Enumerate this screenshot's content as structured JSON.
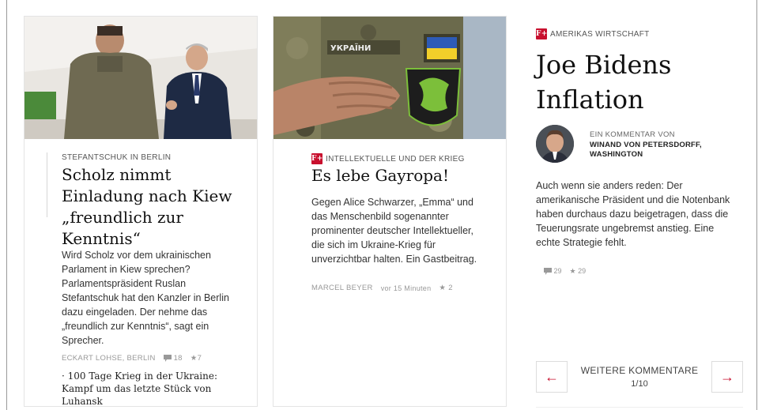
{
  "article1": {
    "kicker": "STEFANTSCHUK IN BERLIN",
    "headline": "Scholz nimmt Einladung nach Kiew „freundlich zur Kenntnis“",
    "teaser": "Wird Scholz vor dem ukrainischen Parlament in Kiew sprechen? Parlamentspräsident Ruslan Stefantschuk hat den Kanzler in Berlin dazu eingeladen. Der nehme das „freundlich zur Kenntnis“, sagt ein Sprecher.",
    "author": "ECKART LOHSE, BERLIN",
    "comments": "18",
    "stars": "7",
    "related": "· 100 Tage Krieg in der Ukraine: Kampf um das letzte Stück von Luhansk"
  },
  "article2": {
    "badge": "F+",
    "kicker": "INTELLEKTUELLE UND DER KRIEG",
    "headline": "Es lebe Gayropa!",
    "teaser": "Gegen Alice Schwarzer, „Emma“ und das Menschenbild sogenannter prominenter deutscher Intellektueller, die sich im Ukraine-Krieg für unverzichtbar halten. Ein Gastbeitrag.",
    "author": "MARCEL BEYER",
    "time": "vor 15 Minuten",
    "stars": "2",
    "patch_text": "УКРАЇНИ"
  },
  "commentary": {
    "badge": "F+",
    "kicker": "AMERIKAS WIRTSCHAFT",
    "headline": "Joe Bidens Inflation",
    "author_prefix": "EIN KOMMENTAR VON",
    "author_name": "WINAND VON PETERSDORFF, WASHINGTON",
    "teaser": "Auch wenn sie anders reden: Der amerikanische Präsident und die Notenbank haben durchaus dazu beigetragen, dass die Teuerungsrate ungebremst anstieg. Eine echte Strategie fehlt.",
    "comments": "29",
    "stars": "29"
  },
  "pager": {
    "prev": "←",
    "next": "→",
    "label": "WEITERE KOMMENTARE",
    "count": "1/10"
  },
  "colors": {
    "accent": "#c8102e"
  },
  "icons": [
    "comment-icon",
    "star-icon",
    "arrow-left-icon",
    "arrow-right-icon",
    "fplus-badge-icon"
  ]
}
